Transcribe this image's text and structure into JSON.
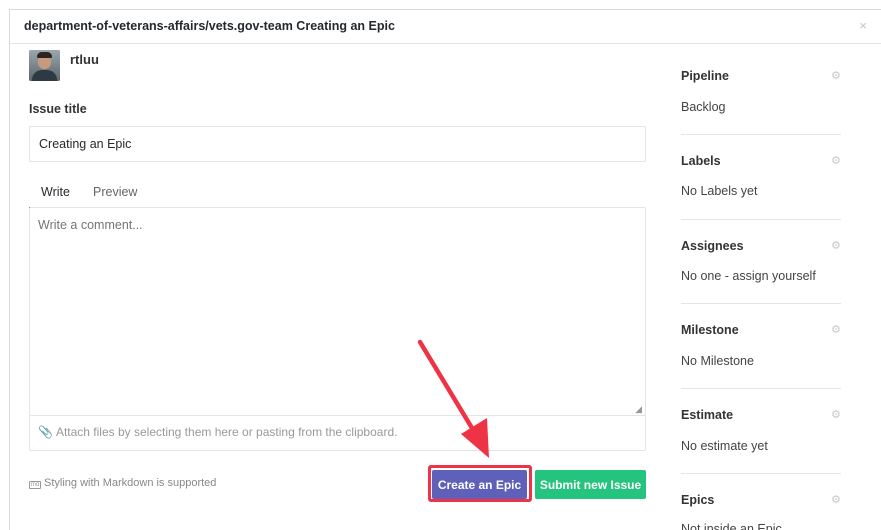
{
  "modal": {
    "title": "department-of-veterans-affairs/vets.gov-team Creating an Epic",
    "close_glyph": "×"
  },
  "author": {
    "username": "rtluu"
  },
  "issue": {
    "title_label": "Issue title",
    "title_value": "Creating an Epic"
  },
  "editor": {
    "tabs": [
      {
        "label": "Write",
        "active": true
      },
      {
        "label": "Preview",
        "active": false
      }
    ],
    "comment_placeholder": "Write a comment...",
    "attach_text": "Attach files by selecting them here or pasting from the clipboard.",
    "markdown_hint": "Styling with Markdown is supported",
    "markdown_icon_text": "md"
  },
  "actions": {
    "create_epic_label": "Create an Epic",
    "submit_label": "Submit new Issue"
  },
  "sidebar": {
    "sections": [
      {
        "title": "Pipeline",
        "value": "Backlog"
      },
      {
        "title": "Labels",
        "value": "No Labels yet"
      },
      {
        "title": "Assignees",
        "value": "No one - assign yourself"
      },
      {
        "title": "Milestone",
        "value": "No Milestone"
      },
      {
        "title": "Estimate",
        "value": "No estimate yet"
      },
      {
        "title": "Epics",
        "value": "Not inside an Epic"
      }
    ]
  },
  "colors": {
    "primary_button": "#5e60ba",
    "success_button": "#25c47e",
    "annotation_red": "#ee3344"
  }
}
